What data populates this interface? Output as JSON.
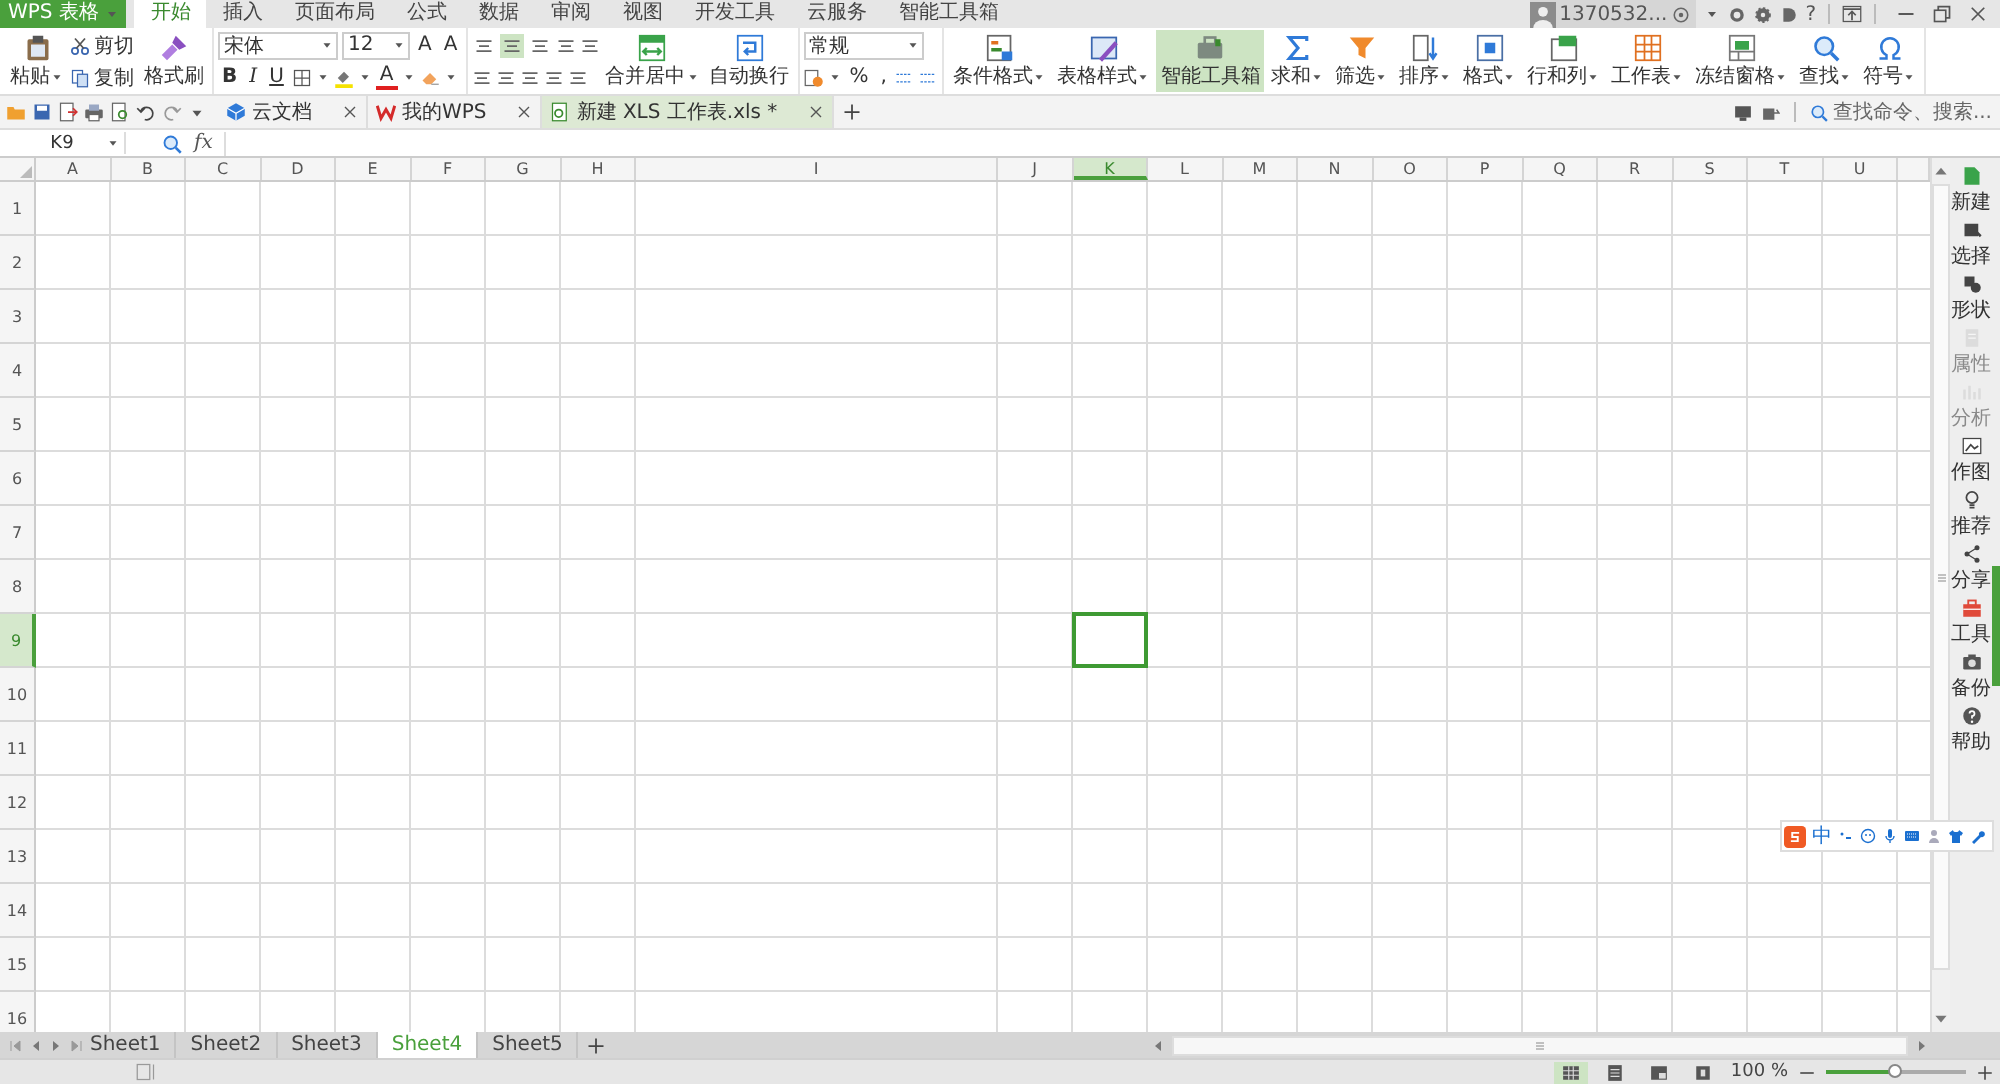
{
  "app_button": {
    "label": "WPS 表格"
  },
  "menu_tabs": [
    {
      "label": "开始",
      "selected": true
    },
    {
      "label": "插入",
      "selected": false
    },
    {
      "label": "页面布局",
      "selected": false
    },
    {
      "label": "公式",
      "selected": false
    },
    {
      "label": "数据",
      "selected": false
    },
    {
      "label": "审阅",
      "selected": false
    },
    {
      "label": "视图",
      "selected": false
    },
    {
      "label": "开发工具",
      "selected": false
    },
    {
      "label": "云服务",
      "selected": false
    },
    {
      "label": "智能工具箱",
      "selected": false
    }
  ],
  "account": {
    "name": "1370532...",
    "help": "?"
  },
  "ribbon": {
    "clipboard": {
      "paste": "粘贴",
      "cut": "剪切",
      "copy": "复制",
      "format_painter": "格式刷"
    },
    "font": {
      "family": "宋体",
      "size": "12",
      "grow": "A",
      "shrink": "A",
      "styles": [
        "B",
        "I",
        "U"
      ],
      "color_button": "A"
    },
    "alignment": {
      "vertical": [
        {
          "selected": false
        },
        {
          "selected": true
        },
        {
          "selected": false
        }
      ],
      "merge": "合并居中",
      "wrap": "自动换行"
    },
    "number": {
      "format": "常规",
      "percent": "%",
      "thousands": ","
    },
    "tools": [
      {
        "label": "条件格式",
        "selected": false
      },
      {
        "label": "表格样式",
        "selected": false
      },
      {
        "label": "智能工具箱",
        "selected": true
      },
      {
        "label": "求和",
        "selected": false
      },
      {
        "label": "筛选",
        "selected": false
      },
      {
        "label": "排序",
        "selected": false
      },
      {
        "label": "格式",
        "selected": false
      },
      {
        "label": "行和列",
        "selected": false
      },
      {
        "label": "工作表",
        "selected": false
      },
      {
        "label": "冻结窗格",
        "selected": false
      },
      {
        "label": "查找",
        "selected": false
      },
      {
        "label": "符号",
        "selected": false
      }
    ]
  },
  "doc_tabs": [
    {
      "label": "云文档",
      "selected": false
    },
    {
      "label": "我的WPS",
      "selected": false
    },
    {
      "label": "新建 XLS 工作表.xls *",
      "selected": true
    }
  ],
  "search": {
    "placeholder": "查找命令、搜索..."
  },
  "formula_bar": {
    "name_box": "K9",
    "fx": "fx"
  },
  "columns": [
    {
      "label": "A",
      "selected": false
    },
    {
      "label": "B",
      "selected": false
    },
    {
      "label": "C",
      "selected": false
    },
    {
      "label": "D",
      "selected": false
    },
    {
      "label": "E",
      "selected": false
    },
    {
      "label": "F",
      "selected": false
    },
    {
      "label": "G",
      "selected": false
    },
    {
      "label": "H",
      "selected": false
    },
    {
      "label": "I",
      "selected": false
    },
    {
      "label": "J",
      "selected": false
    },
    {
      "label": "K",
      "selected": true
    },
    {
      "label": "L",
      "selected": false
    },
    {
      "label": "M",
      "selected": false
    },
    {
      "label": "N",
      "selected": false
    },
    {
      "label": "O",
      "selected": false
    },
    {
      "label": "P",
      "selected": false
    },
    {
      "label": "Q",
      "selected": false
    },
    {
      "label": "R",
      "selected": false
    },
    {
      "label": "S",
      "selected": false
    },
    {
      "label": "T",
      "selected": false
    },
    {
      "label": "U",
      "selected": false
    }
  ],
  "rows": [
    {
      "label": "1",
      "selected": false
    },
    {
      "label": "2",
      "selected": false
    },
    {
      "label": "3",
      "selected": false
    },
    {
      "label": "4",
      "selected": false
    },
    {
      "label": "5",
      "selected": false
    },
    {
      "label": "6",
      "selected": false
    },
    {
      "label": "7",
      "selected": false
    },
    {
      "label": "8",
      "selected": false
    },
    {
      "label": "9",
      "selected": true
    },
    {
      "label": "10",
      "selected": false
    },
    {
      "label": "11",
      "selected": false
    },
    {
      "label": "12",
      "selected": false
    },
    {
      "label": "13",
      "selected": false
    },
    {
      "label": "14",
      "selected": false
    },
    {
      "label": "15",
      "selected": false
    },
    {
      "label": "16",
      "selected": false
    }
  ],
  "sidebar": [
    {
      "label": "新建",
      "disabled": false
    },
    {
      "label": "选择",
      "disabled": false
    },
    {
      "label": "形状",
      "disabled": false
    },
    {
      "label": "属性",
      "disabled": true
    },
    {
      "label": "分析",
      "disabled": true
    },
    {
      "label": "作图",
      "disabled": false
    },
    {
      "label": "推荐",
      "disabled": false
    },
    {
      "label": "分享",
      "disabled": false
    },
    {
      "label": "工具",
      "disabled": false
    },
    {
      "label": "备份",
      "disabled": false
    },
    {
      "label": "帮助",
      "disabled": false
    }
  ],
  "sheets": [
    {
      "label": "Sheet1",
      "selected": false
    },
    {
      "label": "Sheet2",
      "selected": false
    },
    {
      "label": "Sheet3",
      "selected": false
    },
    {
      "label": "Sheet4",
      "selected": true
    },
    {
      "label": "Sheet5",
      "selected": false
    }
  ],
  "status_bar": {
    "views": [
      {
        "selected": true
      },
      {
        "selected": false
      },
      {
        "selected": false
      },
      {
        "selected": false
      }
    ],
    "zoom": "100 %",
    "zoom_slider": {
      "level": 0.5
    }
  },
  "ime_toolbar": {
    "mode": "中"
  }
}
